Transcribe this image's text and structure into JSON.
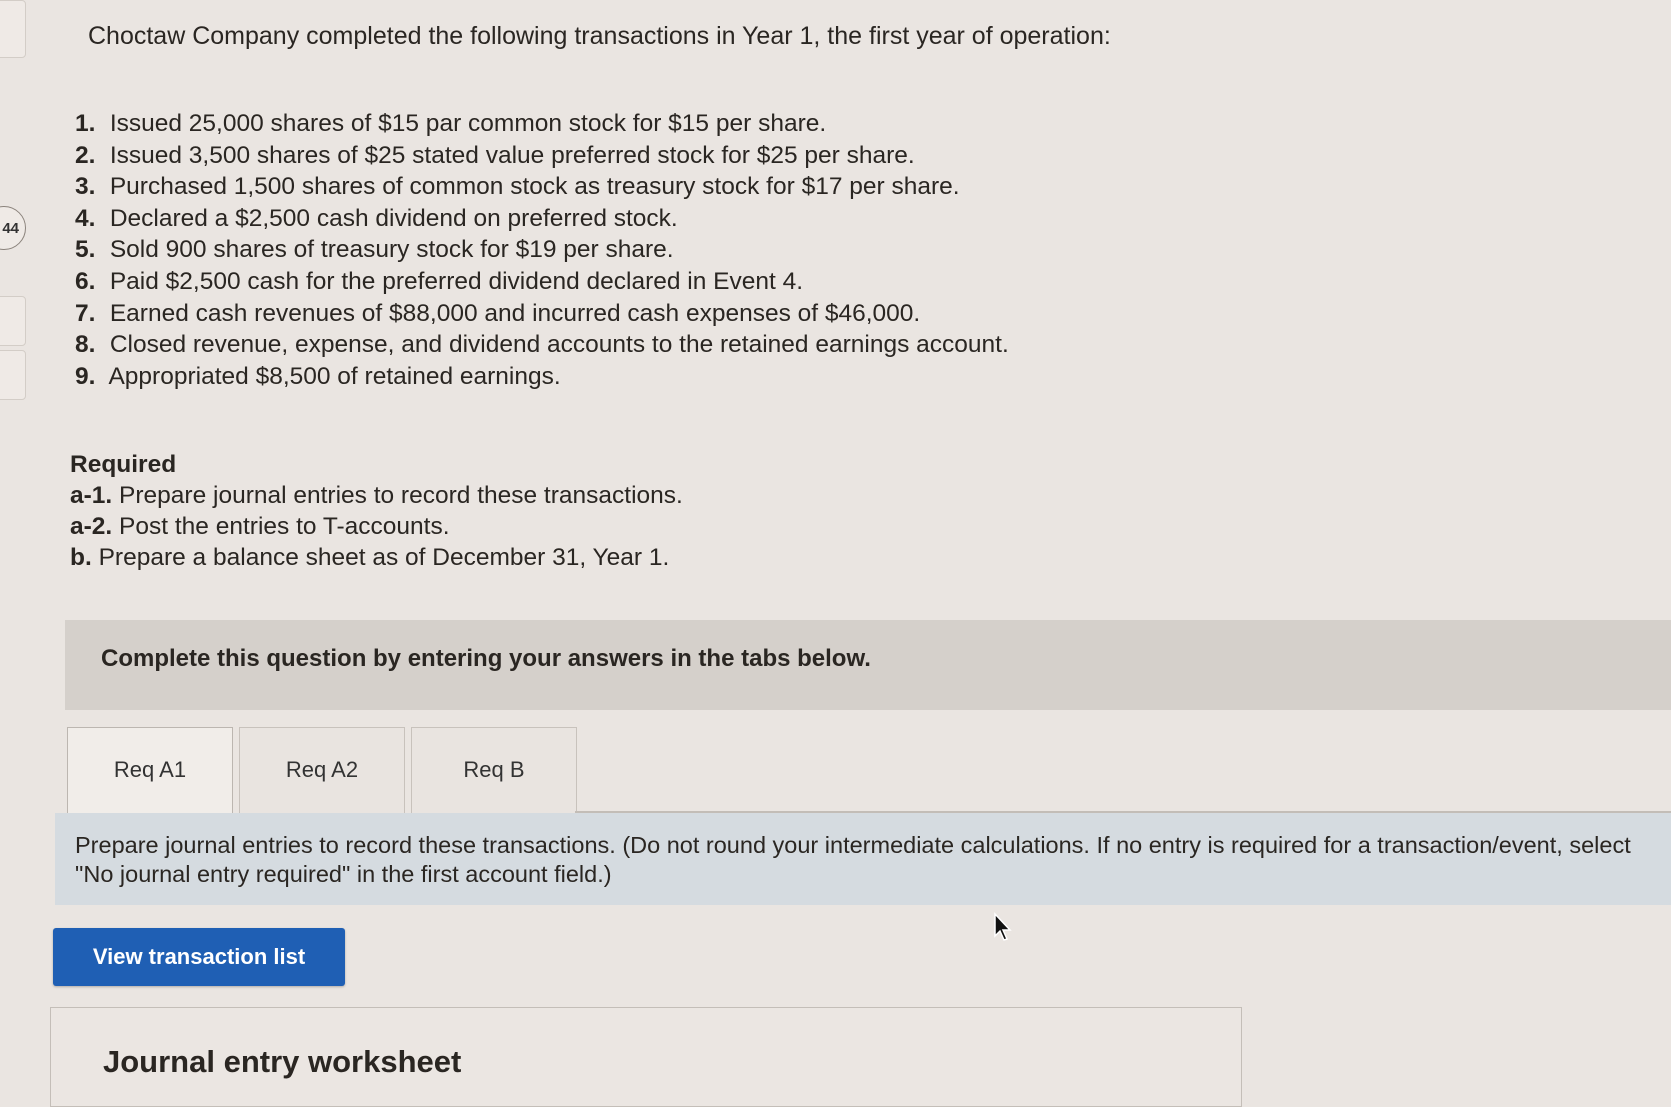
{
  "rail": {
    "circle_label": "44"
  },
  "intro": "Choctaw Company completed the following transactions in Year 1, the first year of operation:",
  "transactions": [
    {
      "num": "1.",
      "text": "Issued 25,000 shares of $15 par common stock for $15 per share."
    },
    {
      "num": "2.",
      "text": "Issued 3,500 shares of $25 stated value preferred stock for $25 per share."
    },
    {
      "num": "3.",
      "text": "Purchased 1,500 shares of common stock as treasury stock for $17 per share."
    },
    {
      "num": "4.",
      "text": "Declared a $2,500 cash dividend on preferred stock."
    },
    {
      "num": "5.",
      "text": "Sold 900 shares of treasury stock for $19 per share."
    },
    {
      "num": "6.",
      "text": "Paid $2,500 cash for the preferred dividend declared in Event 4."
    },
    {
      "num": "7.",
      "text": "Earned cash revenues of $88,000 and incurred cash expenses of $46,000."
    },
    {
      "num": "8.",
      "text": "Closed revenue, expense, and dividend accounts to the retained earnings account."
    },
    {
      "num": "9.",
      "text": "Appropriated $8,500 of retained earnings."
    }
  ],
  "required": {
    "title": "Required",
    "items": [
      {
        "code": "a-1.",
        "text": "Prepare journal entries to record these transactions."
      },
      {
        "code": "a-2.",
        "text": "Post the entries to T-accounts."
      },
      {
        "code": "b.",
        "text": "Prepare a balance sheet as of December 31, Year 1."
      }
    ]
  },
  "banner": "Complete this question by entering your answers in the tabs below.",
  "tabs": [
    {
      "label": "Req A1",
      "active": true
    },
    {
      "label": "Req A2",
      "active": false
    },
    {
      "label": "Req B",
      "active": false
    }
  ],
  "instruction": "Prepare journal entries to record these transactions. (Do not round your intermediate calculations. If no entry is required for a transaction/event, select \"No journal entry required\" in the first account field.)",
  "view_button": "View transaction list",
  "worksheet_title": "Journal entry worksheet",
  "colors": {
    "button": "#1f5fb4",
    "banner": "#d5d0cb",
    "instruction_bg": "#d5dbe0",
    "page_bg": "#eae5e1"
  }
}
